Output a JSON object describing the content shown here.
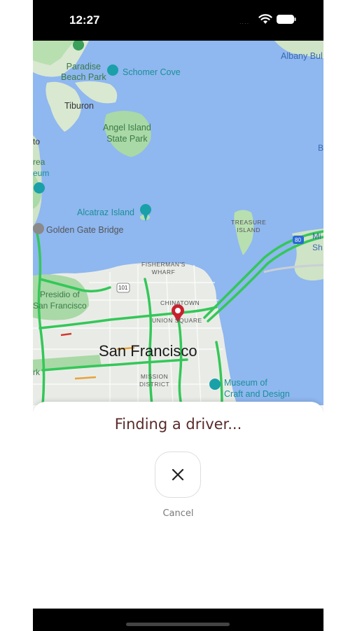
{
  "status_bar": {
    "time": "12:27",
    "signal_dots": "....",
    "wifi_icon": "wifi-icon",
    "battery_icon": "battery-icon"
  },
  "map": {
    "labels": {
      "paradise_beach_park": "Paradise\nBeach Park",
      "schomer_cove": "Schomer Cove",
      "albany_bulb": "Albany Bul",
      "tiburon": "Tiburon",
      "angel_island": "Angel Island\nState Park",
      "to": "to",
      "area": "rea",
      "eum": "eum",
      "b_edge": "B",
      "alcatraz_island": "Alcatraz Island",
      "golden_gate_bridge": "Golden Gate Bridge",
      "treasure_island": "TREASURE\nISLAND",
      "mi": "Mi",
      "sh": "Sh",
      "fishermans_wharf": "FISHERMAN'S\nWHARF",
      "presidio": "Presidio of\nSan Francisco",
      "chinatown": "CHINATOWN",
      "union_square": "UNION SQUARE",
      "san_francisco": "San Francisco",
      "rk": "rk",
      "mission_district": "MISSION\nDISTRICT",
      "museum_craft": "Museum of\nCraft and Design",
      "hwy_101": "101",
      "hwy_80": "80"
    }
  },
  "sheet": {
    "title": "Finding a driver...",
    "cancel_icon": "close-icon",
    "cancel_label": "Cancel"
  },
  "colors": {
    "water": "#8fb7f0",
    "land": "#d7e6cf",
    "park": "#a9d9a6",
    "traffic": "#34c759",
    "accent_text": "#5a2a2a"
  }
}
